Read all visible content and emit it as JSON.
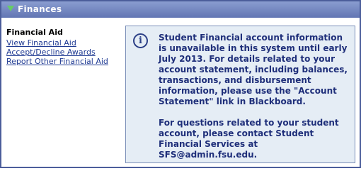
{
  "panel": {
    "title": "Finances"
  },
  "nav": {
    "heading": "Financial Aid",
    "links": [
      "View Financial Aid",
      "Accept/Decline Awards",
      "Report Other Financial Aid"
    ]
  },
  "info": {
    "icon": "info-icon",
    "paragraph1": "Student Financial account information is unavailable in this system until early July 2013. For details related to your account statement, including balances, transactions, and disbursement information, please use the \"Account Statement\" link in Blackboard.",
    "paragraph2": "For questions related to your student account, please contact Student Financial Services at SFS@admin.fsu.edu."
  },
  "colors": {
    "header": "#6275b3",
    "border": "#4c5e9b",
    "link": "#1f3a93",
    "info_bg": "#e5edf5",
    "info_text": "#1f2f7a",
    "toggle": "#66cc66"
  }
}
